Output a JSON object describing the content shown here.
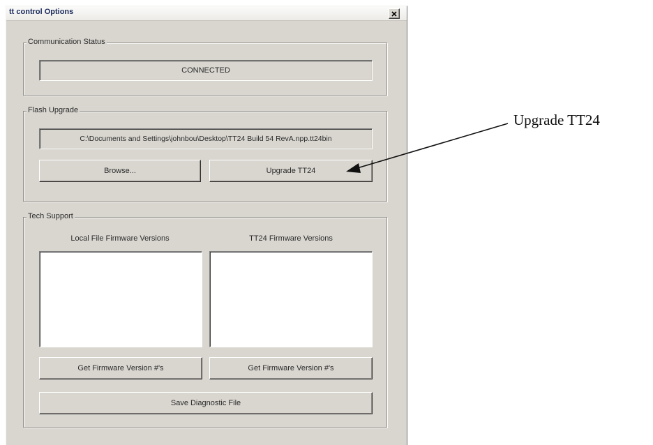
{
  "window": {
    "title": "tt control Options"
  },
  "communication": {
    "group_label": "Communication Status",
    "status": "CONNECTED"
  },
  "flash": {
    "group_label": "Flash Upgrade",
    "file_path": "C:\\Documents and Settings\\johnbou\\Desktop\\TT24 Build 54 RevA.npp.tt24bin",
    "browse_label": "Browse...",
    "upgrade_label": "Upgrade TT24"
  },
  "tech": {
    "group_label": "Tech Support",
    "local_header": "Local File Firmware Versions",
    "tt24_header": "TT24 Firmware Versions",
    "get_local_label": "Get Firmware Version #'s",
    "get_tt24_label": "Get Firmware Version #'s",
    "save_label": "Save Diagnostic File"
  },
  "annotation": {
    "text": "Upgrade TT24"
  }
}
